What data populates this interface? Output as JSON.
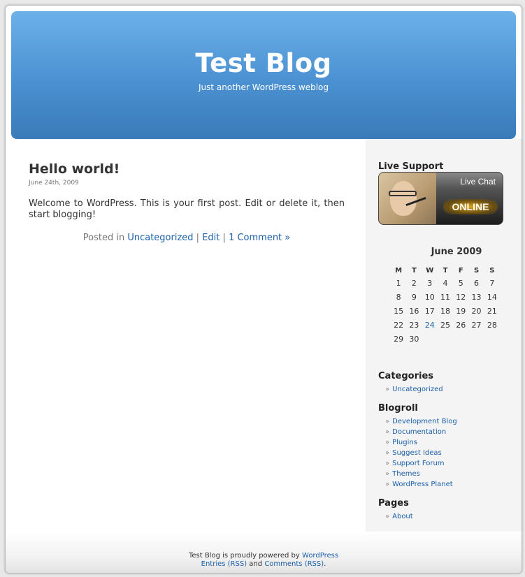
{
  "header": {
    "title": "Test Blog",
    "description": "Just another WordPress weblog"
  },
  "post": {
    "title": "Hello world!",
    "date": "June 24th, 2009",
    "body": "Welcome to WordPress. This is your first post. Edit or delete it, then start blogging!",
    "meta_prefix": "Posted in",
    "category": "Uncategorized",
    "sep1": "|",
    "edit": "Edit",
    "sep2": "|",
    "comments": "1 Comment »"
  },
  "sidebar": {
    "live_support": {
      "title": "Live Support",
      "widget_label": "Live Chat",
      "status": "ONLINE"
    },
    "calendar": {
      "caption": "June 2009",
      "weekdays": [
        "M",
        "T",
        "W",
        "T",
        "F",
        "S",
        "S"
      ],
      "weeks": [
        [
          "1",
          "2",
          "3",
          "4",
          "5",
          "6",
          "7"
        ],
        [
          "8",
          "9",
          "10",
          "11",
          "12",
          "13",
          "14"
        ],
        [
          "15",
          "16",
          "17",
          "18",
          "19",
          "20",
          "21"
        ],
        [
          "22",
          "23",
          "24",
          "25",
          "26",
          "27",
          "28"
        ],
        [
          "29",
          "30",
          "",
          "",
          "",
          "",
          ""
        ]
      ],
      "linked_day": "24"
    },
    "categories": {
      "title": "Categories",
      "items": [
        "Uncategorized"
      ]
    },
    "blogroll": {
      "title": "Blogroll",
      "items": [
        "Development Blog",
        "Documentation",
        "Plugins",
        "Suggest Ideas",
        "Support Forum",
        "Themes",
        "WordPress Planet"
      ]
    },
    "pages": {
      "title": "Pages",
      "items": [
        "About"
      ]
    },
    "bullet": "»"
  },
  "footer": {
    "line1_prefix": "Test Blog is proudly powered by",
    "wordpress_link": "WordPress",
    "entries_rss": "Entries (RSS)",
    "and": "and",
    "comments_rss": "Comments (RSS)",
    "period": "."
  },
  "colors": {
    "header_top": "#6cb1e9",
    "header_bottom": "#3a7ab8",
    "link": "#1a5fa8",
    "sidebar_bg": "#f4f4f4"
  }
}
